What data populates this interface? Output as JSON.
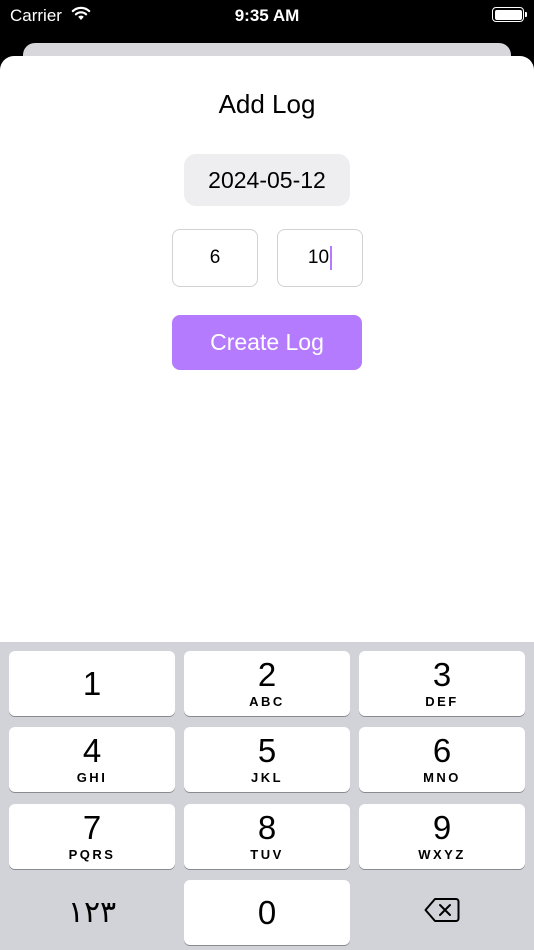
{
  "status_bar": {
    "carrier": "Carrier",
    "time": "9:35 AM"
  },
  "sheet": {
    "title": "Add Log",
    "date": "2024-05-12",
    "hours_value": "6",
    "minutes_value": "10",
    "create_label": "Create Log"
  },
  "keyboard": {
    "keys": [
      {
        "digit": "1",
        "letters": ""
      },
      {
        "digit": "2",
        "letters": "ABC"
      },
      {
        "digit": "3",
        "letters": "DEF"
      },
      {
        "digit": "4",
        "letters": "GHI"
      },
      {
        "digit": "5",
        "letters": "JKL"
      },
      {
        "digit": "6",
        "letters": "MNO"
      },
      {
        "digit": "7",
        "letters": "PQRS"
      },
      {
        "digit": "8",
        "letters": "TUV"
      },
      {
        "digit": "9",
        "letters": "WXYZ"
      },
      {
        "digit": "0",
        "letters": ""
      }
    ],
    "alt_label": "١٢٣",
    "delete_icon": "delete-backward-icon"
  },
  "colors": {
    "accent": "#b57bff",
    "keyboard_bg": "#d1d3d9",
    "date_pill_bg": "#eeeef0"
  }
}
